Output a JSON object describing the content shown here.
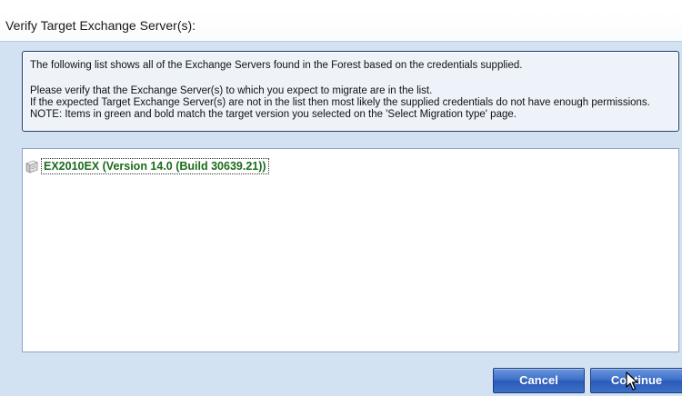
{
  "dialog": {
    "title": "Verify Target Exchange Server(s):"
  },
  "info": {
    "line1": "The following list shows all of the Exchange Servers found in the Forest based on the credentials supplied.",
    "line2": "Please verify that the Exchange Server(s) to which you expect to migrate are in the list.",
    "line3": "If the expected Target Exchange Server(s) are not in the list then most likely the supplied credentials do not have enough permissions.",
    "line4": "NOTE: Items in green and bold match the target version you selected on the 'Select Migration type' page."
  },
  "servers": [
    {
      "label": "EX2010EX (Version 14.0 (Build 30639.21))",
      "icon": "server-icon",
      "color": "#1b6b1b"
    }
  ],
  "buttons": {
    "cancel": "Cancel",
    "continue": "Continue"
  },
  "colors": {
    "accent_button": "#3d6fc9",
    "match_text": "#1b6b1b",
    "panel_border": "#223a63",
    "dialog_background": "#d3e2f3"
  }
}
